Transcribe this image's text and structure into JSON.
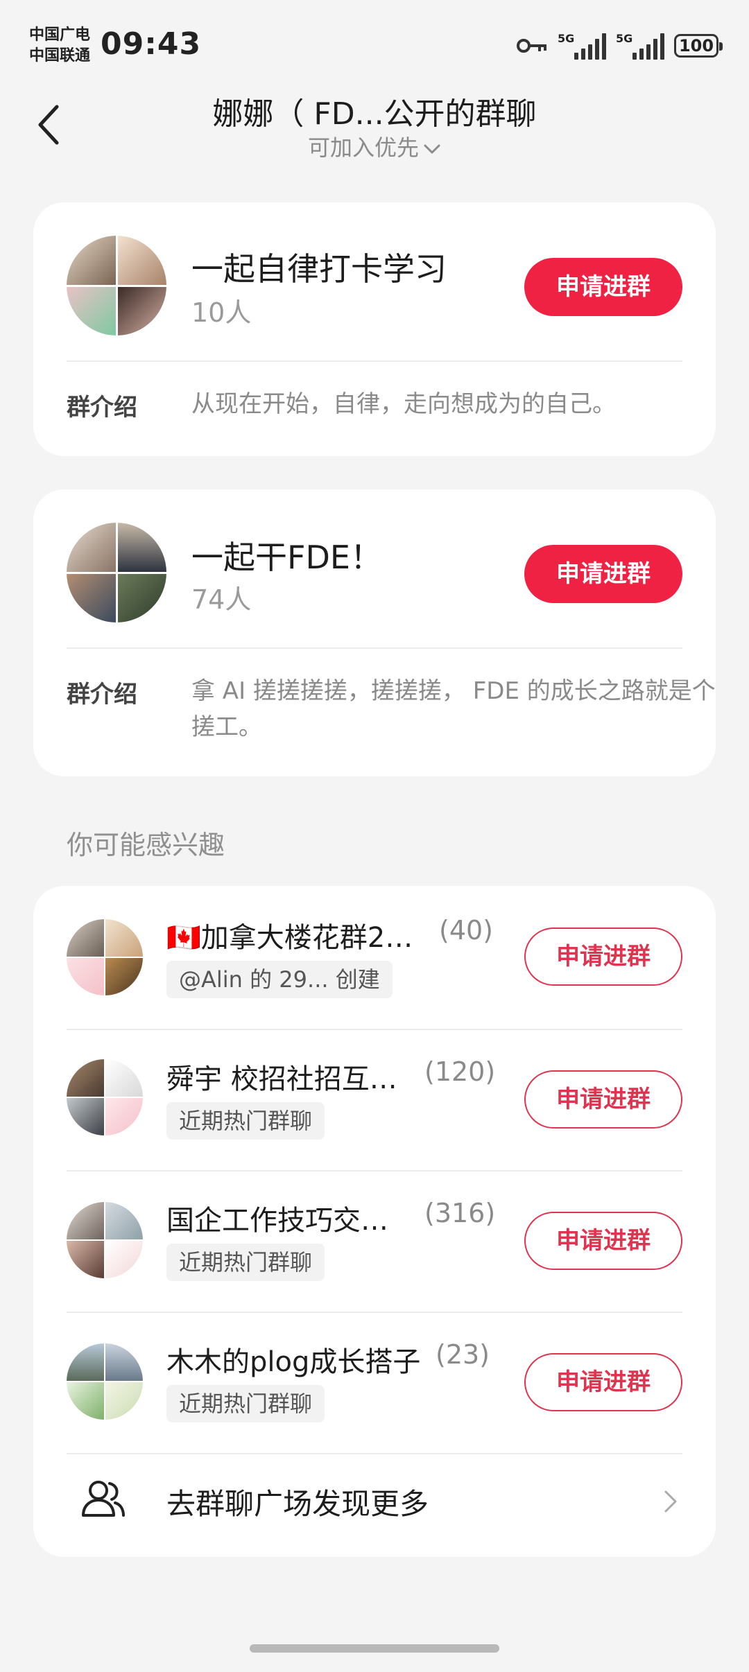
{
  "status": {
    "carrier1": "中国广电",
    "carrier2": "中国联通",
    "time": "09:43",
    "net1": "5G",
    "net2": "5G",
    "battery": "100"
  },
  "header": {
    "back_icon": "chevron-left-icon",
    "title": "娜娜（ FD...公开的群聊",
    "subtitle": "可加入优先"
  },
  "groups": [
    {
      "name": "一起自律打卡学习",
      "count": "10人",
      "button": "申请进群",
      "intro_label": "群介绍",
      "intro": "从现在开始，自律，走向想成为的自己。"
    },
    {
      "name": " 一起干FDE！",
      "count": "74人",
      "button": "申请进群",
      "intro_label": "群介绍",
      "intro": "拿 AI 搓搓搓搓，搓搓搓， FDE 的成长之路就是个搓工。"
    }
  ],
  "section_title": "你可能感兴趣",
  "recommendations": [
    {
      "name": "🇨🇦加拿大楼花群2…",
      "count": "(40)",
      "tag": "@Alin 的 29... 创建",
      "button": "申请进群"
    },
    {
      "name": "舜宇 校招社招互…",
      "count": "(120)",
      "tag": "近期热门群聊",
      "button": "申请进群"
    },
    {
      "name": "国企工作技巧交…",
      "count": "(316)",
      "tag": "近期热门群聊",
      "button": "申请进群"
    },
    {
      "name": "木木的plog成长搭子",
      "count": "(23)",
      "tag": "近期热门群聊",
      "button": "申请进群"
    }
  ],
  "more": {
    "icon": "users-icon",
    "label": "去群聊广场发现更多",
    "chevron": "chevron-right-icon"
  },
  "colors": {
    "accent": "#ef2244",
    "background": "#f4f4f4"
  }
}
